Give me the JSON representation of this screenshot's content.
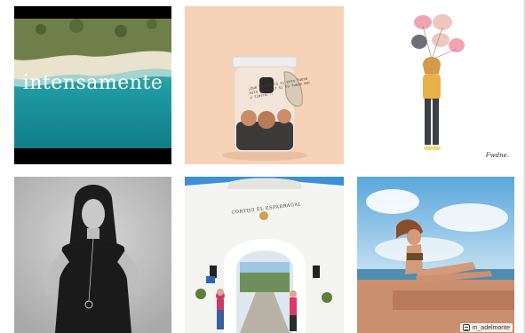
{
  "gallery": {
    "posts": [
      {
        "kind": "video-cover",
        "caption": "intensamente"
      },
      {
        "kind": "product-jar",
        "label_text": "¿Qué harías tú si esto fuese solo para ti? Si tú fuese mar y tierra..."
      },
      {
        "kind": "illustration",
        "signature": "Fwdne."
      },
      {
        "kind": "portrait-bw"
      },
      {
        "kind": "archway",
        "sign_text": "CORTIJO EL ESPARRAGAL"
      },
      {
        "kind": "beach-pose",
        "repost_handle": "m_adelmonte"
      }
    ]
  }
}
